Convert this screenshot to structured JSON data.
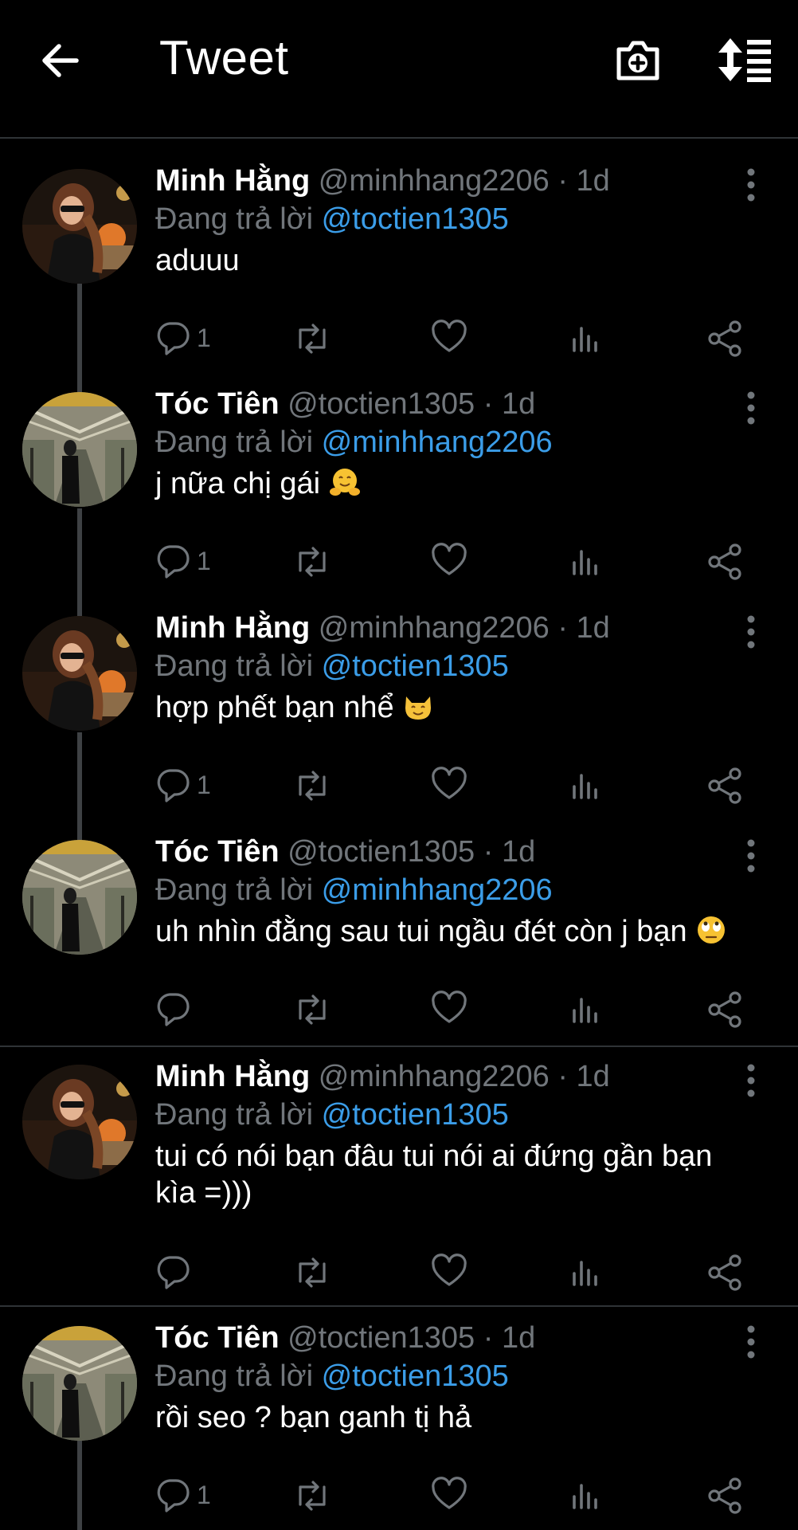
{
  "header": {
    "title": "Tweet",
    "back_icon": "arrow-left-icon",
    "camera_icon": "camera-add-icon",
    "sort_icon": "sort-replies-icon"
  },
  "colors": {
    "background": "#000000",
    "mention": "#3b9de8",
    "muted": "#71767b"
  },
  "tweets": [
    {
      "name": "Minh Hằng",
      "handle": "@minhhang2206 · 1d",
      "replying": "Đang trả lời",
      "mention": "@toctien1305",
      "text": "aduuu",
      "reply_count": "1"
    },
    {
      "name": "Tóc Tiên",
      "handle": "@toctien1305 · 1d",
      "replying": "Đang trả lời",
      "mention": "@minhhang2206",
      "text": "j nữa chị gái",
      "emoji": "hugging-face-emoji",
      "reply_count": "1"
    },
    {
      "name": "Minh Hằng",
      "handle": "@minhhang2206 · 1d",
      "replying": "Đang trả lời",
      "mention": "@toctien1305",
      "text": "hợp phết bạn nhể",
      "emoji": "cat-face-emoji",
      "reply_count": "1"
    },
    {
      "name": "Tóc Tiên",
      "handle": "@toctien1305 · 1d",
      "replying": "Đang trả lời",
      "mention": "@minhhang2206",
      "text": "uh nhìn đằng sau tui ngầu đét còn j bạn",
      "emoji": "eye-roll-emoji",
      "reply_count": ""
    },
    {
      "name": "Minh Hằng",
      "handle": "@minhhang2206 · 1d",
      "replying": "Đang trả lời",
      "mention": "@toctien1305",
      "text": "tui có nói bạn đâu tui nói ai đứng gần bạn kìa =)))",
      "reply_count": ""
    },
    {
      "name": "Tóc Tiên",
      "handle": "@toctien1305 · 1d",
      "replying": "Đang trả lời",
      "mention": "@toctien1305",
      "text": "rồi seo ? bạn ganh tị hả",
      "reply_count": "1"
    }
  ]
}
